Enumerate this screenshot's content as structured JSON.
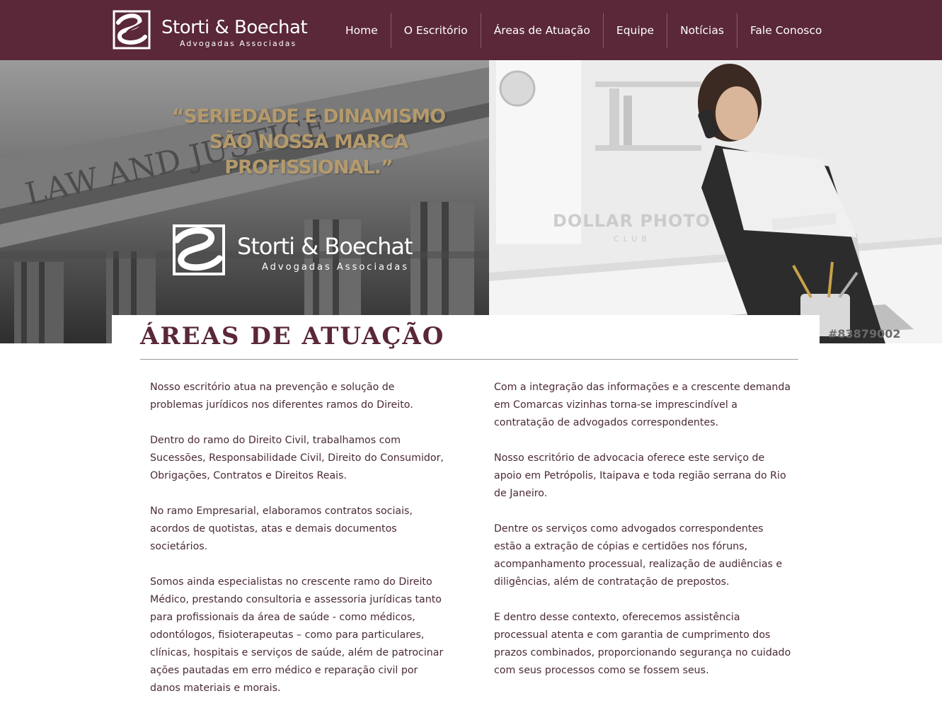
{
  "header": {
    "brand_name": "Storti & Boechat",
    "brand_tagline": "Advogadas Associadas",
    "nav": [
      "Home",
      "O Escritório",
      "Áreas de Atuação",
      "Equipe",
      "Notícias",
      "Fale Conosco"
    ]
  },
  "hero": {
    "quote_line1": "“SERIEDADE E DINAMISMO",
    "quote_line2": "SÃO NOSSA MARCA PROFISSIONAL.”",
    "brand_name": "Storti & Boechat",
    "brand_tagline": "Advogadas Associadas",
    "building_inscription": "LAW AND JUSTICE",
    "watermark": "DOLLAR PHOTO",
    "watermark_sub": "CLUB",
    "stock_id": "#83879002"
  },
  "main": {
    "title": "ÁREAS DE ATUAÇÃO",
    "left_paragraphs": [
      "Nosso escritório atua na prevenção e solução de problemas jurídicos nos diferentes ramos do Direito.",
      "Dentro do ramo do Direito Civil, trabalhamos com Sucessões, Responsabilidade Civil, Direito do Consumidor, Obrigações, Contratos e Direitos Reais.",
      "No ramo Empresarial, elaboramos contratos sociais, acordos de quotistas, atas e demais documentos societários.",
      "Somos ainda especialistas no crescente ramo do Direito Médico, prestando consultoria e assessoria jurídicas tanto para profissionais da área de saúde - como médicos, odontólogos, fisioterapeutas – como para particulares, clínicas, hospitais e serviços de saúde, além de patrocinar ações pautadas em erro médico e reparação civil por danos materiais e morais."
    ],
    "right_paragraphs": [
      "Com a integração das informações e a crescente demanda em Comarcas vizinhas torna-se imprescindível a contratação de advogados correspondentes.",
      "Nosso escritório de advocacia oferece este serviço de apoio em Petrópolis, Itaipava e toda região serrana do Rio de Janeiro.",
      "Dentre os serviços como advogados correspondentes estão a extração de cópias e certidões nos fóruns, acompanhamento processual, realização de audiências e diligências, além de contratação de prepostos.",
      "E dentro desse contexto, oferecemos assistência processual atenta e com garantia de cumprimento dos prazos combinados, proporcionando segurança no cuidado com seus processos como se fossem seus."
    ]
  },
  "colors": {
    "brand": "#5a2838",
    "quote_gold": "#b49a6c",
    "text": "#4a2a36"
  },
  "icons": {
    "brand_logo": "sb-monogram-logo"
  }
}
